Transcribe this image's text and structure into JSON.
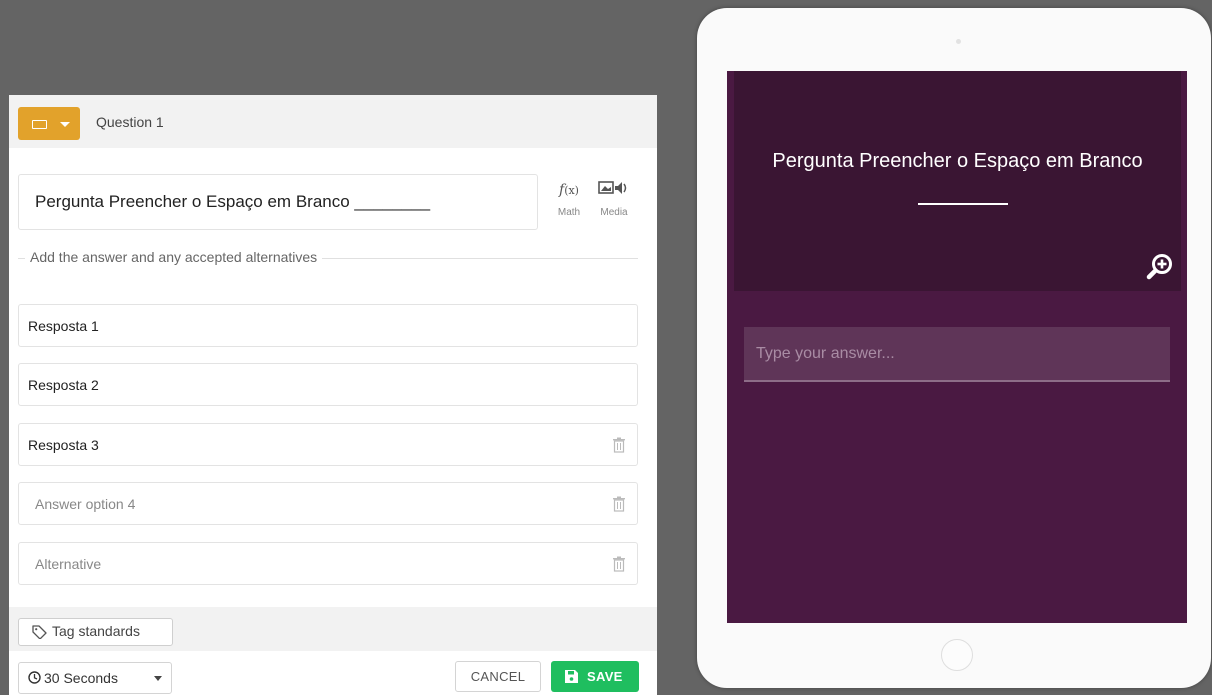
{
  "editor": {
    "question_label": "Question 1",
    "question_text": "Pergunta Preencher o Espaço em Branco ________",
    "tools": {
      "math_label": "Math",
      "media_label": "Media"
    },
    "hint": "Add the answer and any accepted alternatives",
    "answers": [
      {
        "value": "Resposta 1",
        "placeholder": ""
      },
      {
        "value": "Resposta 2",
        "placeholder": ""
      },
      {
        "value": "Resposta 3",
        "placeholder": ""
      },
      {
        "value": "",
        "placeholder": "Answer option 4"
      },
      {
        "value": "",
        "placeholder": "Alternative"
      }
    ],
    "tag_label": "Tag standards",
    "time_selected": "30 Seconds",
    "cancel_label": "CANCEL",
    "save_label": "SAVE"
  },
  "preview": {
    "question_title": "Pergunta Preencher o Espaço em Branco",
    "answer_placeholder": "Type your answer..."
  },
  "colors": {
    "background": "#646464",
    "type_button": "#e2a22b",
    "save_button": "#1fbe5f",
    "preview_bg": "#4a1942",
    "preview_question_bg": "#3a1533"
  },
  "icons": [
    "rectangle-icon",
    "chevron-down-icon",
    "function-icon",
    "media-icon",
    "trash-icon",
    "tag-icon",
    "clock-icon",
    "floppy-disk-icon",
    "zoom-in-icon"
  ]
}
